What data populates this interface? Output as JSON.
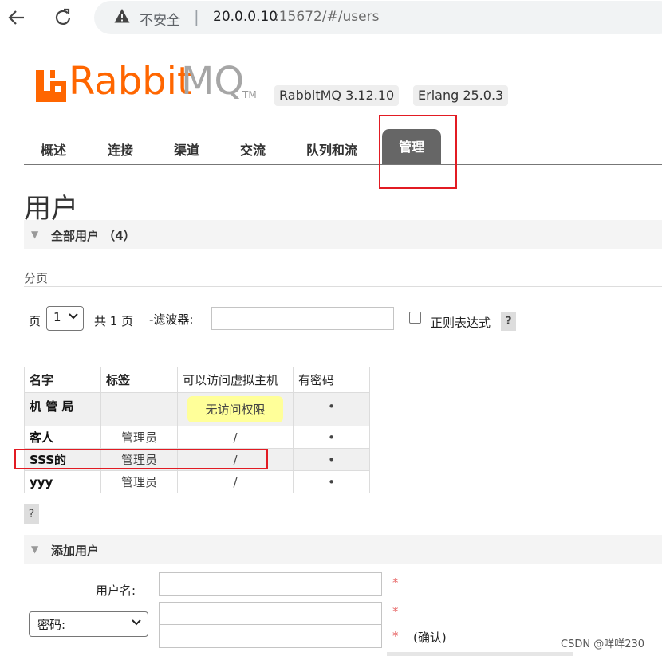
{
  "browser": {
    "security_label": "不安全",
    "separator": "|",
    "url_host": "20.0.0.10",
    "url_rest": ":15672/#/users",
    "icons": {
      "back": "arrow-left-icon",
      "reload": "reload-icon",
      "warning": "warning-triangle-icon"
    }
  },
  "header": {
    "logo_primary": "RabbitMQ",
    "logo_rabbit": "Rabbit",
    "logo_mq": "MQ",
    "logo_tm": "TM",
    "rabbitmq_version": "RabbitMQ 3.12.10",
    "erlang_version": "Erlang 25.0.3",
    "brand_color": "#ff6600"
  },
  "tabs": [
    {
      "label": "概述"
    },
    {
      "label": "连接"
    },
    {
      "label": "渠道"
    },
    {
      "label": "交流"
    },
    {
      "label": "队列和流"
    },
    {
      "label": "管理",
      "active": true
    }
  ],
  "page": {
    "title": "用户",
    "all_users_section": "全部用户 （4）",
    "pagination_label": "分页"
  },
  "pagination": {
    "page_word": "页",
    "current_page": "1",
    "total_label": "共 1 页",
    "filter_label": "-滤波器:",
    "filter_value": "",
    "regex_label": "正则表达式",
    "regex_checked": false,
    "help": "?"
  },
  "users_table": {
    "headers": [
      "名字",
      "标签",
      "可以访问虚拟主机",
      "有密码"
    ],
    "rows": [
      {
        "name": "机 管 局",
        "tags": "",
        "vhosts": "无访问权限",
        "has_password": "•"
      },
      {
        "name": "客人",
        "tags": "管理员",
        "vhosts": "/",
        "has_password": "•"
      },
      {
        "name": "SSS的",
        "tags": "管理员",
        "vhosts": "/",
        "has_password": "•"
      },
      {
        "name": "yyy",
        "tags": "管理员",
        "vhosts": "/",
        "has_password": "•"
      }
    ],
    "help": "?"
  },
  "add_user": {
    "section_title": "添加用户",
    "username_label": "用户名:",
    "username_value": "",
    "password_type": "密码:",
    "password_value": "",
    "confirm_value": "",
    "required_mark": "*",
    "confirm_label": "(确认)"
  },
  "watermark": "CSDN @咩咩230",
  "colors": {
    "highlight": "#e21b23",
    "active_tab": "#666666",
    "no_access_bg": "#ffff99"
  }
}
